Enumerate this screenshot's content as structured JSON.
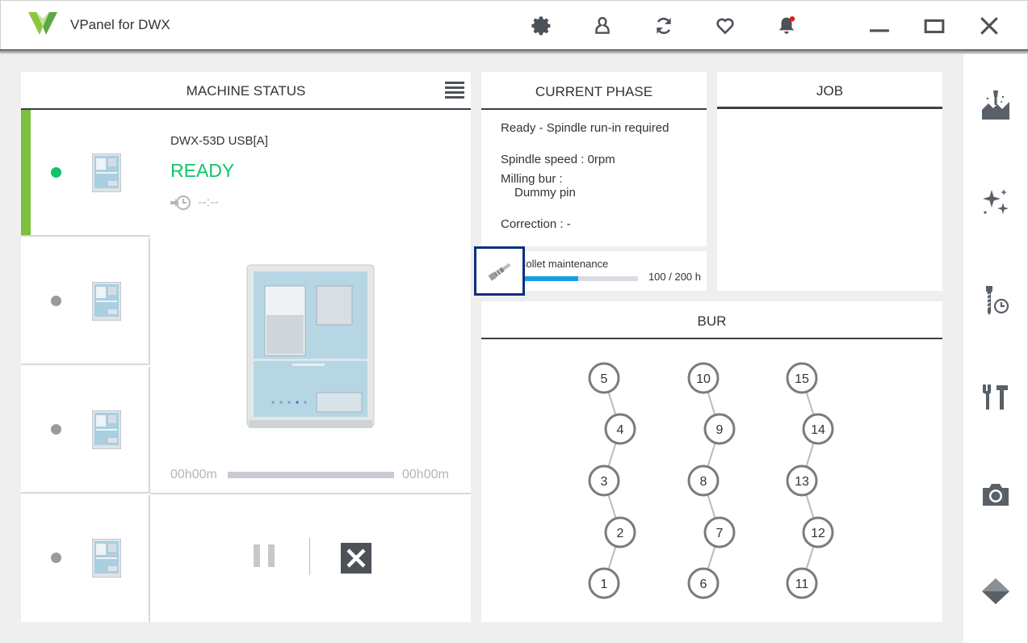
{
  "app": {
    "title": "VPanel for DWX"
  },
  "toolbar": {
    "icons": [
      "settings-icon",
      "user-icon",
      "refresh-icon",
      "favorite-icon",
      "notification-icon"
    ],
    "window_controls": [
      "minimize-icon",
      "maximize-icon",
      "close-icon"
    ]
  },
  "machine_status": {
    "header": "MACHINE STATUS",
    "machines": [
      {
        "status": "active"
      },
      {
        "status": "idle"
      },
      {
        "status": "idle"
      },
      {
        "status": "idle"
      }
    ],
    "selected": {
      "name": "DWX-53D USB[A]",
      "state": "READY",
      "remaining": "--:--",
      "elapsed": "00h00m",
      "total": "00h00m",
      "progress": 0
    }
  },
  "current_phase": {
    "header": "CURRENT PHASE",
    "status": "Ready - Spindle run-in required",
    "spindle_speed": "Spindle speed : 0rpm",
    "milling_bur_label": "Milling bur :",
    "milling_bur_value": "Dummy pin",
    "correction": "Correction : -"
  },
  "collet": {
    "label": "Collet maintenance",
    "value_text": "100 / 200 h",
    "fraction": 0.5
  },
  "job": {
    "header": "JOB"
  },
  "bur": {
    "header": "BUR",
    "columns": [
      [
        "5",
        "4",
        "3",
        "2",
        "1"
      ],
      [
        "10",
        "9",
        "8",
        "7",
        "6"
      ],
      [
        "15",
        "14",
        "13",
        "12",
        "11"
      ]
    ]
  },
  "sidebar": {
    "icons": [
      "milling-icon",
      "sparkle-icon",
      "bur-timer-icon",
      "tools-icon",
      "camera-icon",
      "diamond-icon"
    ]
  },
  "colors": {
    "ready": "#12c36a",
    "accent": "#7dbf3e",
    "progress": "#15a2e2",
    "header_rule": "#3a3f47"
  }
}
